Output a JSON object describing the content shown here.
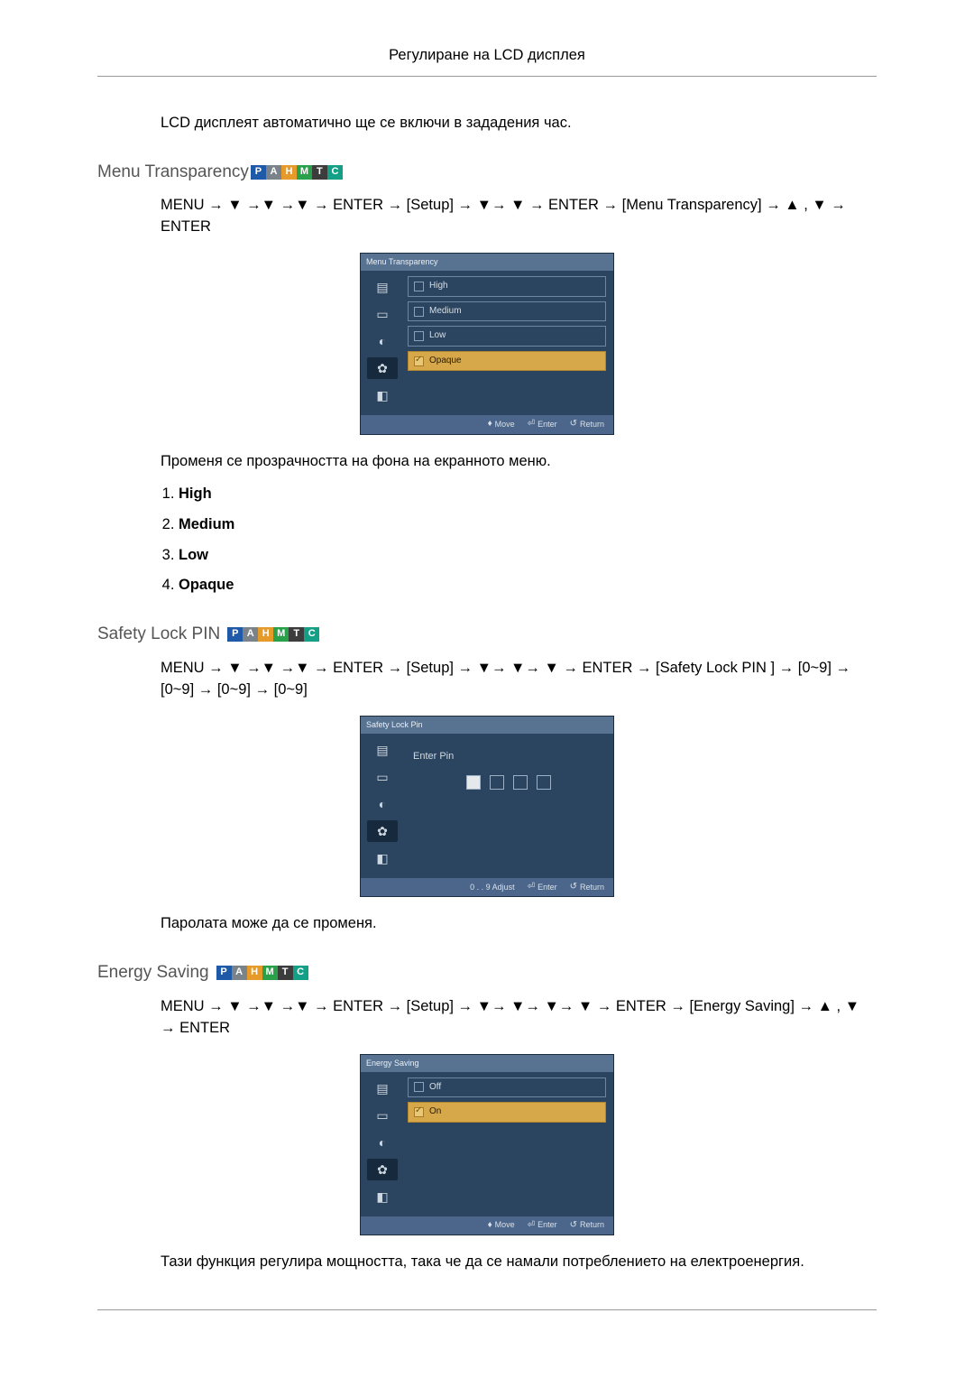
{
  "header": {
    "title": "Регулиране на LCD дисплея"
  },
  "intro_auto": "LCD дисплеят автоматично ще се включи в зададения час.",
  "sec_menu_transparency": {
    "heading": "Menu Transparency",
    "path": "MENU → ▼ →▼ →▼ → ENTER → [Setup] → ▼→ ▼ → ENTER → [Menu Transparency] → ▲ , ▼ → ENTER",
    "osd": {
      "title": "Menu Transparency",
      "options": [
        "High",
        "Medium",
        "Low",
        "Opaque"
      ],
      "selected_index": 3,
      "footer": {
        "move": "Move",
        "enter": "Enter",
        "return": "Return"
      }
    },
    "desc": "Променя се прозрачността на фона на екранното меню.",
    "list": [
      "High",
      "Medium",
      "Low",
      "Opaque"
    ]
  },
  "sec_safety_lock": {
    "heading": "Safety Lock PIN",
    "path": "MENU → ▼ →▼ →▼ → ENTER → [Setup] → ▼→ ▼→ ▼ → ENTER → [Safety Lock PIN ] → [0~9] → [0~9] → [0~9] → [0~9]",
    "osd": {
      "title": "Safety Lock Pin",
      "enter_pin_label": "Enter  Pin",
      "footer": {
        "adjust": "0 . . 9  Adjust",
        "enter": "Enter",
        "return": "Return"
      }
    },
    "desc": "Паролата може да се променя."
  },
  "sec_energy_saving": {
    "heading": "Energy Saving",
    "path": "MENU → ▼ →▼ →▼ → ENTER → [Setup] → ▼→ ▼→ ▼→ ▼ → ENTER → [Energy Saving] → ▲ , ▼ → ENTER",
    "osd": {
      "title": "Energy Saving",
      "options": [
        "Off",
        "On"
      ],
      "selected_index": 1,
      "footer": {
        "move": "Move",
        "enter": "Enter",
        "return": "Return"
      }
    },
    "desc": "Тази функция регулира мощността, така че да се намали потреблението на електроенергия."
  },
  "badges": [
    "P",
    "A",
    "H",
    "M",
    "T",
    "C"
  ]
}
